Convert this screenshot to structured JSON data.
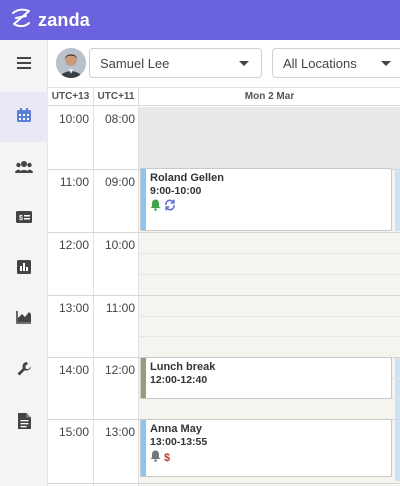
{
  "brand": {
    "name": "zanda",
    "accent": "#6b63dd"
  },
  "sidebar": {
    "items": [
      {
        "name": "menu",
        "icon": "hamburger-icon"
      },
      {
        "name": "calendar",
        "icon": "calendar-icon",
        "active": true
      },
      {
        "name": "clients",
        "icon": "people-icon"
      },
      {
        "name": "billing",
        "icon": "payment-icon"
      },
      {
        "name": "reports",
        "icon": "bar-chart-icon"
      },
      {
        "name": "stats",
        "icon": "area-chart-icon"
      },
      {
        "name": "settings",
        "icon": "wrench-icon"
      },
      {
        "name": "documents",
        "icon": "document-icon"
      }
    ]
  },
  "toolbar": {
    "practitioner": "Samuel Lee",
    "location": "All Locations"
  },
  "calendar": {
    "timezones": [
      "UTC+13",
      "UTC+11"
    ],
    "day_header": "Mon 2 Mar",
    "hours_utc13": [
      "10:00",
      "11:00",
      "12:00",
      "13:00",
      "14:00",
      "15:00"
    ],
    "hours_utc11": [
      "08:00",
      "09:00",
      "10:00",
      "11:00",
      "12:00",
      "13:00"
    ],
    "appointments": [
      {
        "title": "Roland Gellen",
        "time": "9:00-10:00",
        "color": "#8ec5f0",
        "icons": [
          "bell-icon",
          "recurring-icon"
        ]
      },
      {
        "title": "Lunch break",
        "time": "12:00-12:40",
        "color": "#9b9b82",
        "icons": []
      },
      {
        "title": "Anna May",
        "time": "13:00-13:55",
        "color": "#8ec5f0",
        "icons": [
          "bell-icon",
          "dollar-icon"
        ]
      }
    ],
    "dollar_symbol": "$"
  }
}
